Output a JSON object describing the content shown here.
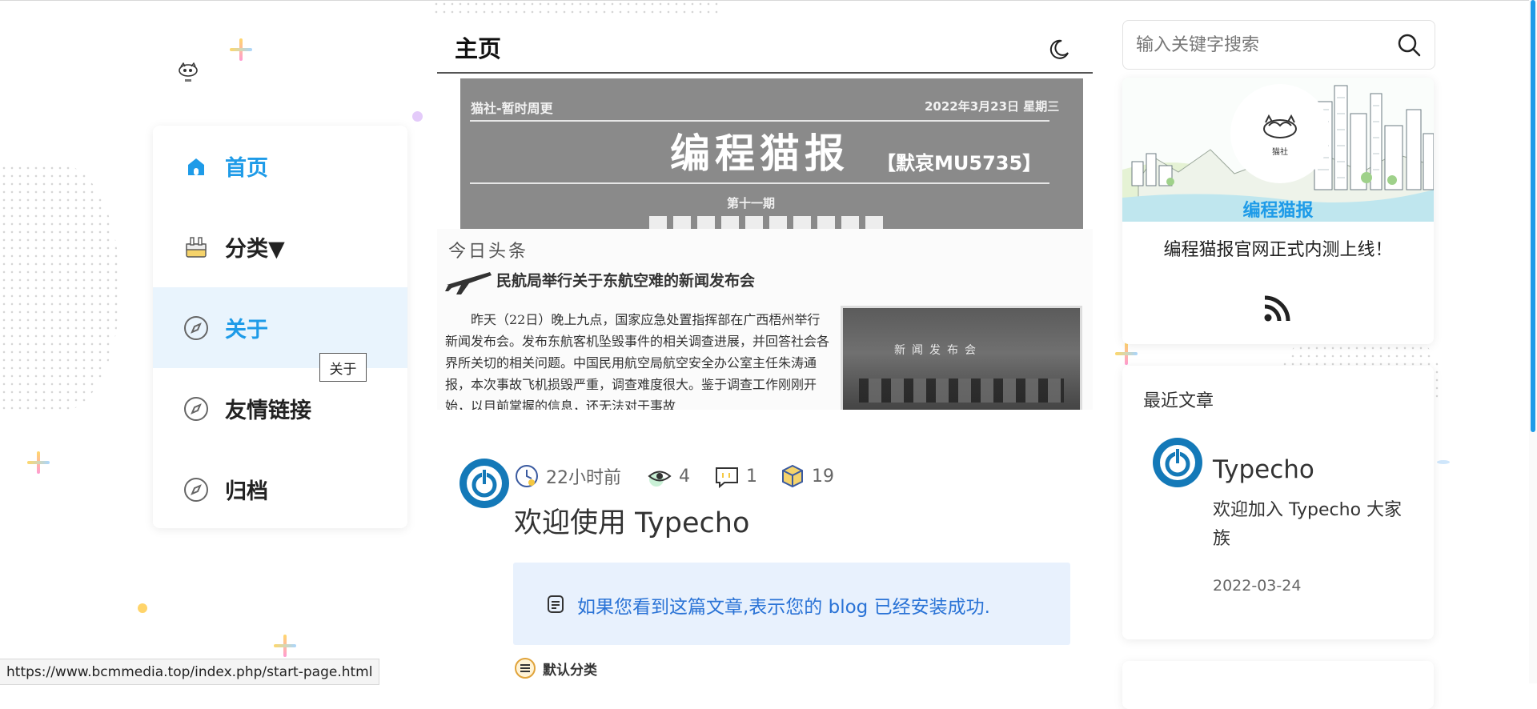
{
  "nav": {
    "items": [
      {
        "label": "首页",
        "icon": "home-icon",
        "state": "active"
      },
      {
        "label": "分类▼",
        "icon": "category-icon",
        "state": "normal"
      },
      {
        "label": "关于",
        "icon": "compass-icon",
        "state": "hover"
      },
      {
        "label": "友情链接",
        "icon": "compass-icon",
        "state": "normal"
      },
      {
        "label": "归档",
        "icon": "compass-icon",
        "state": "normal"
      }
    ],
    "tooltip": "关于"
  },
  "main": {
    "title": "主页",
    "banner": {
      "left_header": "猫社-暂时周更",
      "date_header": "2022年3月23日 星期三",
      "masthead": "编程猫报",
      "subtitle": "【默哀MU5735】",
      "issue": "第十一期",
      "section": "今日头条",
      "headline": "民航局举行关于东航空难的新闻发布会",
      "body": "昨天（22日）晚上九点，国家应急处置指挥部在广西梧州举行新闻发布会。发布东航客机坠毁事件的相关调查进展，并回答社会各界所关切的相关问题。中国民用航空局航空安全办公室主任朱涛通报，本次事故飞机损毁严重，调查难度很大。鉴于调查工作刚刚开始，以目前掌握的信息，还无法对于事故",
      "photo_caption": "新闻发布会"
    }
  },
  "post": {
    "time": "22小时前",
    "views": "4",
    "comments": "1",
    "words": "19",
    "title": "欢迎使用 Typecho",
    "notice": "如果您看到这篇文章,表示您的 blog 已经安装成功.",
    "category": "默认分类"
  },
  "search": {
    "placeholder": "输入关键字搜索"
  },
  "brand": {
    "name": "编程猫报",
    "description": "编程猫报官网正式内测上线！",
    "logo_text": "猫社"
  },
  "recent": {
    "title": "最近文章",
    "items": [
      {
        "name": "Typecho",
        "summary": "欢迎加入 Typecho 大家族",
        "date": "2022-03-24"
      }
    ]
  },
  "status_url": "https://www.bcmmedia.top/index.php/start-page.html",
  "colors": {
    "accent": "#1e9be8",
    "notice_bg": "#e8f1fd",
    "notice_text": "#2a73d6",
    "avatar": "#1479b8"
  }
}
